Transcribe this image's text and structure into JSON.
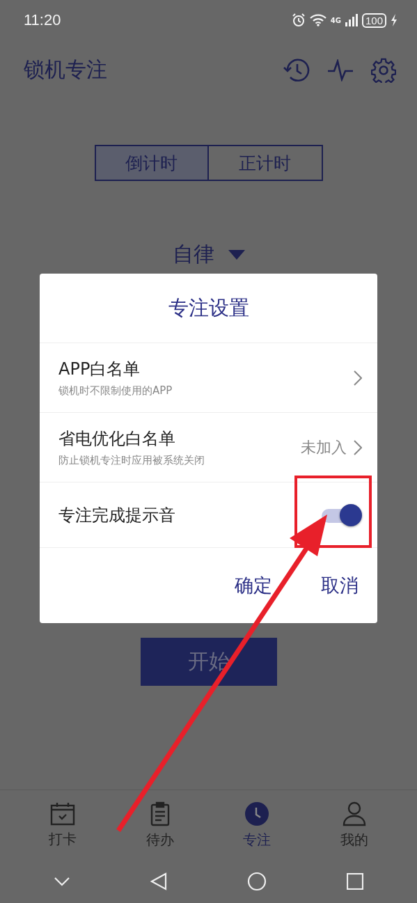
{
  "status_bar": {
    "time": "11:20",
    "network": "4G",
    "battery": "100"
  },
  "app_bar": {
    "title": "锁机专注"
  },
  "mode_tabs": [
    {
      "label": "倒计时",
      "selected": true
    },
    {
      "label": "正计时",
      "selected": false
    }
  ],
  "category": {
    "label": "自律"
  },
  "start_button": {
    "label": "开始"
  },
  "dialog": {
    "title": "专注设置",
    "rows": [
      {
        "kind": "link",
        "title": "APP白名单",
        "subtitle": "锁机时不限制使用的APP"
      },
      {
        "kind": "link",
        "title": "省电优化白名单",
        "subtitle": "防止锁机专注时应用被系统关闭",
        "value": "未加入"
      },
      {
        "kind": "switch",
        "title": "专注完成提示音",
        "on": true
      }
    ],
    "buttons": [
      "确定",
      "取消"
    ]
  },
  "bottom_nav": [
    {
      "label": "打卡",
      "selected": false
    },
    {
      "label": "待办",
      "selected": false
    },
    {
      "label": "专注",
      "selected": true
    },
    {
      "label": "我的",
      "selected": false
    }
  ]
}
